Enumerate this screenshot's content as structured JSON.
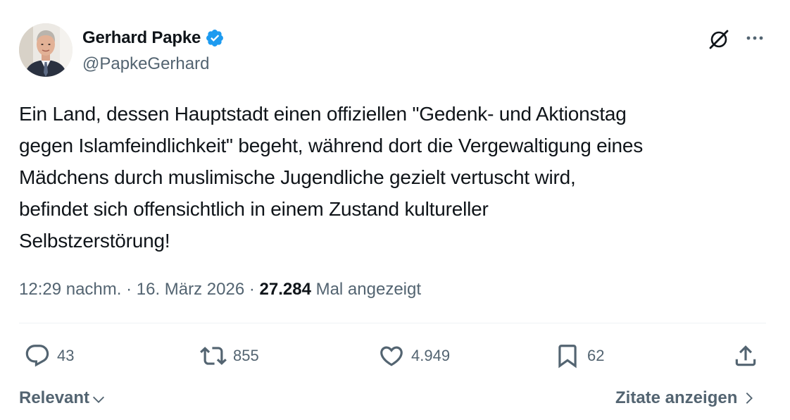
{
  "author": {
    "display_name": "Gerhard Papke",
    "handle": "@PapkeGerhard",
    "verified": true,
    "verified_color": "#1d9bf0"
  },
  "tweet": {
    "text": "Ein Land, dessen Hauptstadt einen offiziellen \"Gedenk- und Aktionstag\ngegen Islamfeindlichkeit\" begeht, während dort die Vergewaltigung eines\nMädchens durch muslimische Jugendliche gezielt vertuscht wird,\nbefindet sich offensichtlich in einem Zustand kultureller\nSelbstzerstörung!"
  },
  "meta": {
    "time": "12:29 nachm.",
    "separator": " · ",
    "date": "16. März 2026",
    "views_count": "27.284",
    "views_label": "Mal angezeigt"
  },
  "actions": {
    "reply_count": "43",
    "retweet_count": "855",
    "like_count": "4.949",
    "bookmark_count": "62"
  },
  "footer": {
    "sort_label": "Relevant",
    "quotes_label": "Zitate anzeigen"
  },
  "icons": {
    "header": [
      "grok-icon",
      "more-icon"
    ],
    "actions": [
      "reply-icon",
      "retweet-icon",
      "like-icon",
      "bookmark-icon",
      "share-icon"
    ]
  },
  "colors": {
    "text_primary": "#0f1419",
    "text_secondary": "#536471",
    "divider": "#eff3f4"
  }
}
